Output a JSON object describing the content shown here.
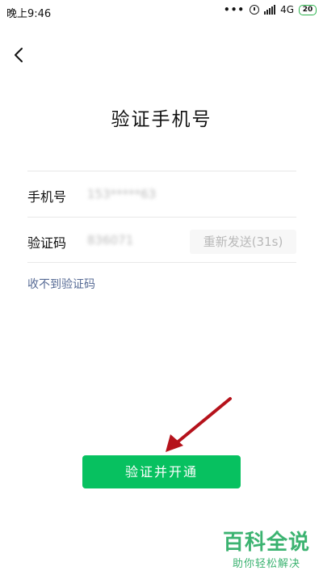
{
  "status_bar": {
    "time": "晚上9:46",
    "notification_dots": "•••",
    "network": "4G",
    "battery_level": "20",
    "battery_color": "#2bb24c"
  },
  "page": {
    "title": "验证手机号"
  },
  "form": {
    "phone_label": "手机号",
    "phone_value": "153*****63",
    "code_label": "验证码",
    "code_value": "836071",
    "resend_label": "重新发送(31s)"
  },
  "no_code_link": "收不到验证码",
  "submit_label": "验证并开通",
  "watermark": {
    "title": "百科全说",
    "subtitle": "助你轻松解决"
  },
  "colors": {
    "primary_green": "#07c160",
    "link_blue": "#576b95",
    "annotation_arrow": "#b5121b"
  },
  "icons": {
    "back": "chevron-left-icon",
    "alarm": "alarm-clock-icon",
    "signal": "signal-bars-icon",
    "battery": "battery-icon",
    "arrow": "red-arrow-annotation"
  }
}
